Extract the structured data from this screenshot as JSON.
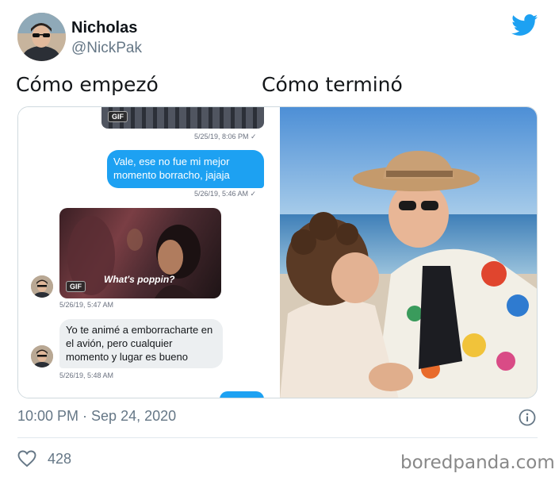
{
  "tweet": {
    "display_name": "Nicholas",
    "handle": "@NickPak",
    "timestamp": "10:00 PM · Sep 24, 2020",
    "likes": "428"
  },
  "captions": {
    "left": "Cómo empezó",
    "right": "Cómo terminó"
  },
  "chat": {
    "gif_badge": "GIF",
    "time_1": "5/25/19, 8:06 PM ✓",
    "message_out": "Vale, ese no fue mi mejor momento borracho, jajaja",
    "time_2": "5/26/19, 5:46 AM ✓",
    "gif_caption": "What's poppin?",
    "time_3": "5/26/19, 5:47 AM",
    "message_in": "Yo te animé a emborracharte en el avión, pero cualquier momento y lugar es bueno",
    "time_4": "5/26/19, 5:48 AM"
  },
  "watermark": "boredpanda.com",
  "colors": {
    "twitter_blue": "#1da1f2",
    "muted_text": "#657786"
  },
  "icons": [
    "twitter-bird-icon",
    "info-icon",
    "heart-icon"
  ]
}
